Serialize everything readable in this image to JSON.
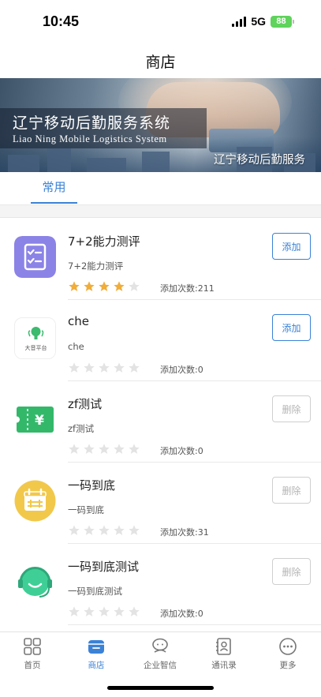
{
  "status_bar": {
    "time": "10:45",
    "network": "5G",
    "battery": "88"
  },
  "nav": {
    "title": "商店"
  },
  "banner": {
    "title_cn": "辽宁移动后勤服务系统",
    "title_en": "Liao Ning Mobile Logistics System",
    "subtitle": "辽宁移动后勤服务"
  },
  "tabs": [
    {
      "label": "常用",
      "active": true
    }
  ],
  "apps": [
    {
      "name": "7+2能力测评",
      "desc": "7+2能力测评",
      "count": "添加次数:211",
      "stars": 4,
      "action": "添加",
      "action_type": "add",
      "icon": "checklist-icon",
      "icon_caption": ""
    },
    {
      "name": "che",
      "desc": "che",
      "count": "添加次数:0",
      "stars": 0,
      "action": "添加",
      "action_type": "add",
      "icon": "speaker-icon",
      "icon_caption": "大音平台"
    },
    {
      "name": "zf测试",
      "desc": "zf测试",
      "count": "添加次数:0",
      "stars": 0,
      "action": "删除",
      "action_type": "delete",
      "icon": "ticket-yuan-icon",
      "icon_caption": ""
    },
    {
      "name": "一码到底",
      "desc": "一码到底",
      "count": "添加次数:31",
      "stars": 0,
      "action": "删除",
      "action_type": "delete",
      "icon": "calendar-icon",
      "icon_caption": ""
    },
    {
      "name": "一码到底测试",
      "desc": "一码到底测试",
      "count": "添加次数:0",
      "stars": 0,
      "action": "删除",
      "action_type": "delete",
      "icon": "headset-icon",
      "icon_caption": ""
    }
  ],
  "bottom_nav": [
    {
      "label": "首页",
      "icon": "grid-icon",
      "active": false
    },
    {
      "label": "商店",
      "icon": "store-icon",
      "active": true
    },
    {
      "label": "企业智信",
      "icon": "chat-bubbles-icon",
      "active": false
    },
    {
      "label": "通讯录",
      "icon": "contacts-icon",
      "active": false
    },
    {
      "label": "更多",
      "icon": "more-icon",
      "active": false
    }
  ],
  "colors": {
    "accent": "#3b82d6",
    "star_on": "#f0ad3a",
    "star_off": "#e3e3e3",
    "battery": "#5fd35b"
  }
}
